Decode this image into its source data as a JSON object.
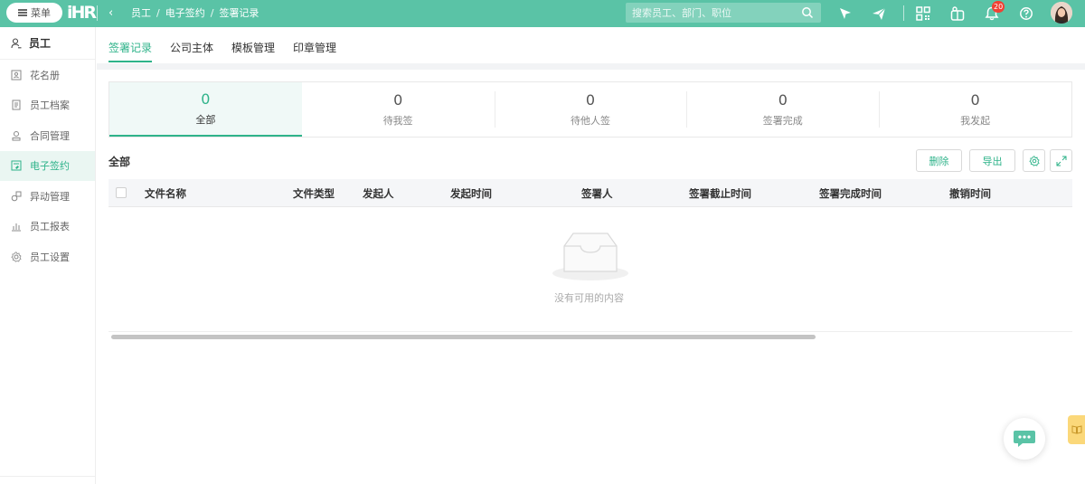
{
  "topbar": {
    "menu_label": "菜单",
    "logo_text": "iHR",
    "breadcrumb": [
      "员工",
      "电子签约",
      "签署记录"
    ],
    "search_placeholder": "搜索员工、部门、职位",
    "notification_count": "20",
    "accent_color": "#5ac3a6"
  },
  "sidebar": {
    "header": "员工",
    "items": [
      {
        "label": "花名册",
        "icon": "roster-icon"
      },
      {
        "label": "员工档案",
        "icon": "file-icon"
      },
      {
        "label": "合同管理",
        "icon": "contract-icon"
      },
      {
        "label": "电子签约",
        "icon": "esign-icon",
        "active": true
      },
      {
        "label": "异动管理",
        "icon": "transfer-icon"
      },
      {
        "label": "员工报表",
        "icon": "report-icon"
      },
      {
        "label": "员工设置",
        "icon": "settings-icon"
      }
    ]
  },
  "tabs": [
    "签署记录",
    "公司主体",
    "模板管理",
    "印章管理"
  ],
  "stats": [
    {
      "value": "0",
      "label": "全部",
      "active": true
    },
    {
      "value": "0",
      "label": "待我签"
    },
    {
      "value": "0",
      "label": "待他人签"
    },
    {
      "value": "0",
      "label": "签署完成"
    },
    {
      "value": "0",
      "label": "我发起"
    }
  ],
  "section": {
    "title": "全部",
    "delete_label": "删除",
    "export_label": "导出"
  },
  "table": {
    "columns": [
      "文件名称",
      "文件类型",
      "发起人",
      "发起时间",
      "签署人",
      "签署截止时间",
      "签署完成时间",
      "撤销时间"
    ],
    "empty_text": "没有可用的内容"
  }
}
